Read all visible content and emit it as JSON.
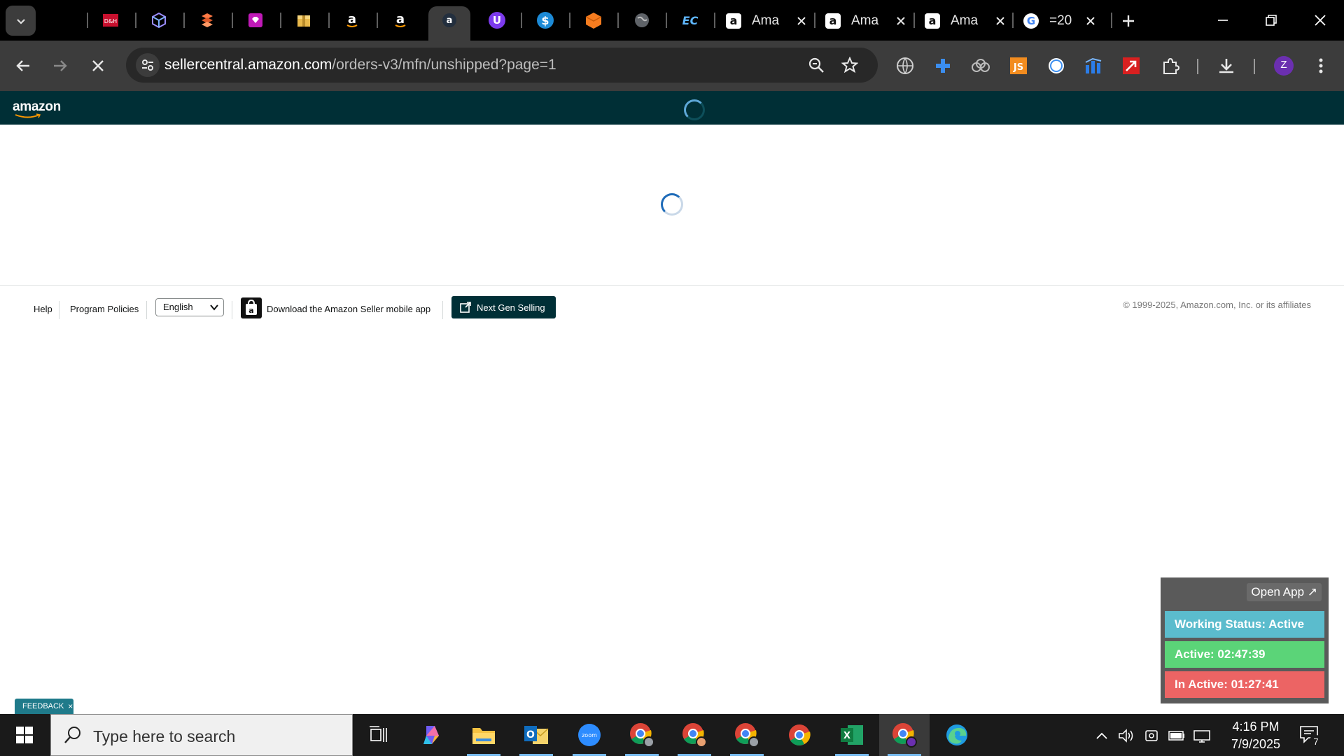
{
  "tabs": {
    "full_tabs": [
      {
        "title": "Ama",
        "favicon": "amazon-a-icon"
      },
      {
        "title": "Ama",
        "favicon": "amazon-a-icon"
      },
      {
        "title": "Ama",
        "favicon": "amazon-a-icon"
      },
      {
        "title": "=20",
        "favicon": "google-g-icon"
      }
    ],
    "pinned": [
      "dh-icon",
      "cube-icon",
      "stack-icon",
      "diamond-icon",
      "box-icon",
      "amazon-icon",
      "amazon-icon",
      "amazon-active-icon",
      "u-icon",
      "dollar-icon",
      "orange-box-icon",
      "globe-icon",
      "ec-icon"
    ]
  },
  "address_bar": {
    "host": "sellercentral.amazon.com",
    "path": "/orders-v3/mfn/unshipped?page=1"
  },
  "extensions": [
    "globe-ext-icon",
    "plus-ext-icon",
    "cloud-ext-icon",
    "js-ext-icon",
    "circle-ext-icon",
    "chart-ext-icon",
    "arrow-ext-icon",
    "puzzle-icon"
  ],
  "profile_initial": "Z",
  "page": {
    "header_logo": "amazon",
    "footer": {
      "help": "Help",
      "policies": "Program Policies",
      "language": "English",
      "download_app": "Download the Amazon Seller mobile app",
      "next_gen": "Next Gen Selling",
      "copyright": "© 1999-2025, Amazon.com, Inc. or its affiliates"
    },
    "feedback": "FEEDBACK",
    "feedback_close": "×"
  },
  "widget": {
    "open_app": "Open App ↗",
    "working_status": "Working Status: Active",
    "active": "Active: 02:47:39",
    "inactive": "In Active: 01:27:41",
    "colors": {
      "working": "#5bbccd",
      "active": "#5bd478",
      "inactive": "#ec6464"
    }
  },
  "taskbar": {
    "search_placeholder": "Type here to search",
    "time": "4:16 PM",
    "date": "7/9/2025",
    "notification_count": "7"
  }
}
